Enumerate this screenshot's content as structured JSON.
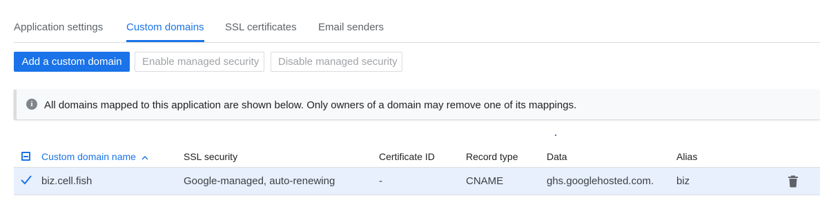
{
  "tabs": [
    {
      "label": "Application settings",
      "active": false
    },
    {
      "label": "Custom domains",
      "active": true
    },
    {
      "label": "SSL certificates",
      "active": false
    },
    {
      "label": "Email senders",
      "active": false
    }
  ],
  "toolbar": {
    "add_label": "Add a custom domain",
    "enable_label": "Enable managed security",
    "disable_label": "Disable managed security"
  },
  "info": {
    "icon": "info-icon",
    "text": "All domains mapped to this application are shown below. Only owners of a domain may remove one of its mappings."
  },
  "table": {
    "columns": {
      "domain": "Custom domain name",
      "ssl": "SSL security",
      "cert": "Certificate ID",
      "record": "Record type",
      "data": "Data",
      "alias": "Alias"
    },
    "sort_icon": "chevron-up-icon",
    "rows": [
      {
        "selected": true,
        "domain": "biz.cell.fish",
        "ssl": "Google-managed, auto-renewing",
        "cert": "-",
        "record": "CNAME",
        "data": "ghs.googlehosted.com.",
        "alias": "biz",
        "action_icon": "trash-icon"
      }
    ]
  },
  "colors": {
    "accent": "#1a73e8",
    "selected_row": "#e8f0fe",
    "text": "#202124",
    "muted": "#5f6368"
  }
}
